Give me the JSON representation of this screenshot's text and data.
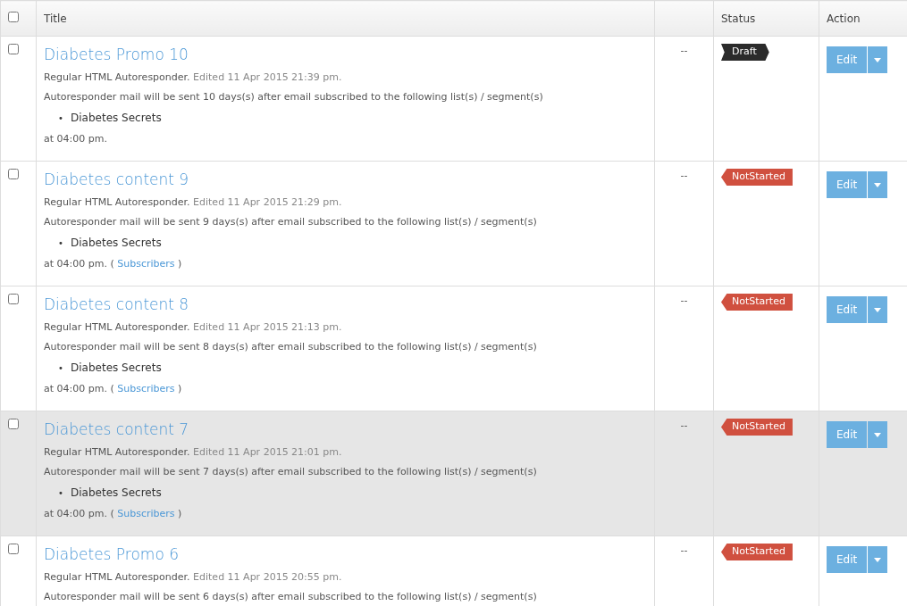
{
  "table": {
    "header": {
      "all_checked": false,
      "columns": [
        "Title",
        "",
        "Status",
        "Action"
      ]
    },
    "rows": [
      {
        "checked": false,
        "hovered": false,
        "title": "Diabetes Promo 10",
        "type": "Regular HTML Autoresponder.",
        "edited": "Edited 11 Apr 2015 21:39 pm.",
        "schedule": "Autoresponder mail will be sent 10 days(s) after email subscribed to the following list(s) / segment(s)",
        "lists": [
          {
            "marker": "•",
            "name": "Diabetes Secrets"
          }
        ],
        "time": "at 04:00 pm.",
        "column_2": "--",
        "status": {
          "kind": "draft",
          "label": "Draft"
        },
        "action": "Edit"
      },
      {
        "checked": false,
        "hovered": false,
        "title": "Diabetes content 9",
        "type": "Regular HTML Autoresponder.",
        "edited": "Edited 11 Apr 2015 21:29 pm.",
        "schedule": "Autoresponder mail will be sent 9 days(s) after email subscribed to the following list(s) / segment(s)",
        "lists": [
          {
            "marker": "•",
            "name": "Diabetes Secrets"
          }
        ],
        "time": "at 04:00 pm. (",
        "link": "Subscribers",
        "time_end": ")",
        "column_2": "--",
        "status": {
          "kind": "notstarted",
          "label": "NotStarted"
        },
        "action": "Edit"
      },
      {
        "checked": false,
        "hovered": false,
        "title": "Diabetes content 8",
        "type": "Regular HTML Autoresponder.",
        "edited": "Edited 11 Apr 2015 21:13 pm.",
        "schedule": "Autoresponder mail will be sent 8 days(s) after email subscribed to the following list(s) / segment(s)",
        "lists": [
          {
            "marker": "•",
            "name": "Diabetes Secrets"
          }
        ],
        "time": "at 04:00 pm. (",
        "link": "Subscribers",
        "time_end": ")",
        "column_2": "--",
        "status": {
          "kind": "notstarted",
          "label": "NotStarted"
        },
        "action": "Edit"
      },
      {
        "checked": false,
        "hovered": true,
        "title": "Diabetes content 7",
        "type": "Regular HTML Autoresponder.",
        "edited": "Edited 11 Apr 2015 21:01 pm.",
        "schedule": "Autoresponder mail will be sent 7 days(s) after email subscribed to the following list(s) / segment(s)",
        "lists": [
          {
            "marker": "•",
            "name": "Diabetes Secrets"
          }
        ],
        "time": "at 04:00 pm. (",
        "link": "Subscribers",
        "time_end": ")",
        "column_2": "--",
        "status": {
          "kind": "notstarted",
          "label": "NotStarted"
        },
        "action": "Edit"
      },
      {
        "checked": false,
        "hovered": false,
        "title": "Diabetes Promo 6",
        "type": "Regular HTML Autoresponder.",
        "edited": "Edited 11 Apr 2015 20:55 pm.",
        "schedule": "Autoresponder mail will be sent 6 days(s) after email subscribed to the following list(s) / segment(s)",
        "column_2": "--",
        "status": {
          "kind": "notstarted",
          "label": "NotStarted"
        },
        "action": "Edit"
      }
    ]
  }
}
